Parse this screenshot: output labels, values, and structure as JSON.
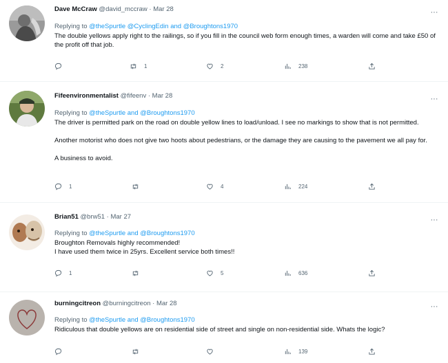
{
  "tweets": [
    {
      "name": "Dave McCraw",
      "handle": "@david_mccraw",
      "date": "Mar 28",
      "reply_prefix": "Replying to ",
      "reply_to": "@theSpurtle @CyclingEdin and @Broughtons1970",
      "body": [
        "The double yellows apply right to the railings, so if you fill in the council web form enough times, a warden will come and take £50 of the profit off that job."
      ],
      "replies": "",
      "retweets": "1",
      "likes": "2",
      "views": "238"
    },
    {
      "name": "Fifeenvironmentalist",
      "handle": "@fifeenv",
      "date": "Mar 28",
      "reply_prefix": "Replying to ",
      "reply_to": "@theSpurtle and @Broughtons1970",
      "body": [
        "The driver is permitted park on the road on double yellow lines to load/unload. I see no markings to show that is not permitted.",
        "Another motorist who does not give two hoots about pedestrians, or the damage they are causing to the pavement we all pay for.",
        "A business to avoid."
      ],
      "replies": "1",
      "retweets": "",
      "likes": "4",
      "views": "224"
    },
    {
      "name": "Brian51",
      "handle": "@brw51",
      "date": "Mar 27",
      "reply_prefix": "Replying to ",
      "reply_to": "@theSpurtle and @Broughtons1970",
      "body": [
        "Broughton Removals highly recommended!",
        "I have used them twice in 25yrs.  Excellent service both times!!"
      ],
      "replies": "1",
      "retweets": "",
      "likes": "5",
      "views": "636"
    },
    {
      "name": "burningcitreon",
      "handle": "@burningcitreon",
      "date": "Mar 28",
      "reply_prefix": "Replying to ",
      "reply_to": "@theSpurtle and @Broughtons1970",
      "body": [
        "Ridiculous that double yellows are on residential side of street and single on non-residential side. Whats the logic?"
      ],
      "replies": "",
      "retweets": "",
      "likes": "",
      "views": "139"
    }
  ],
  "separator": " · ",
  "more_glyph": "···",
  "icons": [
    "reply-icon",
    "retweet-icon",
    "like-icon",
    "views-icon",
    "share-icon",
    "more-icon"
  ],
  "colors": {
    "link": "#1d9bf0",
    "secondary": "#536471",
    "text": "#0f1419",
    "divider": "#eff3f4"
  }
}
